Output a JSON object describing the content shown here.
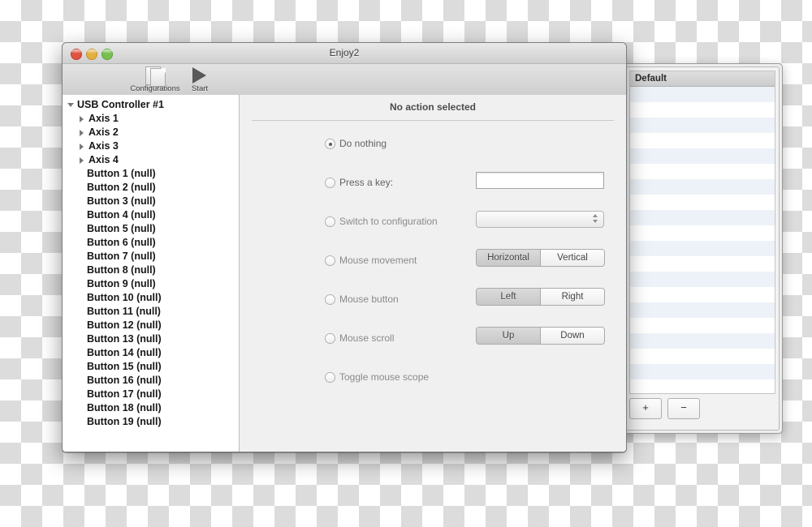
{
  "main_window": {
    "title": "Enjoy2",
    "traffic_lights": [
      {
        "name": "close",
        "color": "#e0533f"
      },
      {
        "name": "minimize",
        "color": "#e3b040"
      },
      {
        "name": "zoom",
        "color": "#78c051"
      }
    ],
    "toolbar": [
      {
        "label": "Configurations",
        "icon": "documents-stack-icon"
      },
      {
        "label": "Start",
        "icon": "play-icon"
      }
    ],
    "sidebar": {
      "root": {
        "label": "USB Controller #1",
        "expanded": true
      },
      "axes": [
        "Axis 1",
        "Axis 2",
        "Axis 3",
        "Axis 4"
      ],
      "buttons": [
        "Button 1 (null)",
        "Button 2 (null)",
        "Button 3 (null)",
        "Button 4 (null)",
        "Button 5 (null)",
        "Button 6 (null)",
        "Button 7 (null)",
        "Button 8 (null)",
        "Button 9 (null)",
        "Button 10 (null)",
        "Button 11 (null)",
        "Button 12 (null)",
        "Button 13 (null)",
        "Button 14 (null)",
        "Button 15 (null)",
        "Button 16 (null)",
        "Button 17 (null)",
        "Button 18 (null)",
        "Button 19 (null)"
      ]
    },
    "detail": {
      "title": "No action selected",
      "options": [
        {
          "label": "Do nothing",
          "selected": true,
          "control": "none"
        },
        {
          "label": "Press a key:",
          "selected": false,
          "control": "textfield"
        },
        {
          "label": "Switch to configuration",
          "selected": false,
          "control": "popup"
        },
        {
          "label": "Mouse movement",
          "selected": false,
          "control": "segmented"
        },
        {
          "label": "Mouse button",
          "selected": false,
          "control": "segmented"
        },
        {
          "label": "Mouse scroll",
          "selected": false,
          "control": "segmented"
        },
        {
          "label": "Toggle mouse scope",
          "selected": false,
          "control": "none"
        }
      ],
      "key_field_value": "",
      "key_field_placeholder": "",
      "configuration_popup_value": "",
      "segments": {
        "mouse_movement": {
          "left": "Horizontal",
          "right": "Vertical",
          "selected": "Horizontal"
        },
        "mouse_button": {
          "left": "Left",
          "right": "Right",
          "selected": "Left"
        },
        "mouse_scroll": {
          "left": "Up",
          "right": "Down",
          "selected": "Up"
        }
      }
    }
  },
  "background_window": {
    "column_header": "Default",
    "add_button": "+",
    "remove_button": "−",
    "row_count": 21
  }
}
